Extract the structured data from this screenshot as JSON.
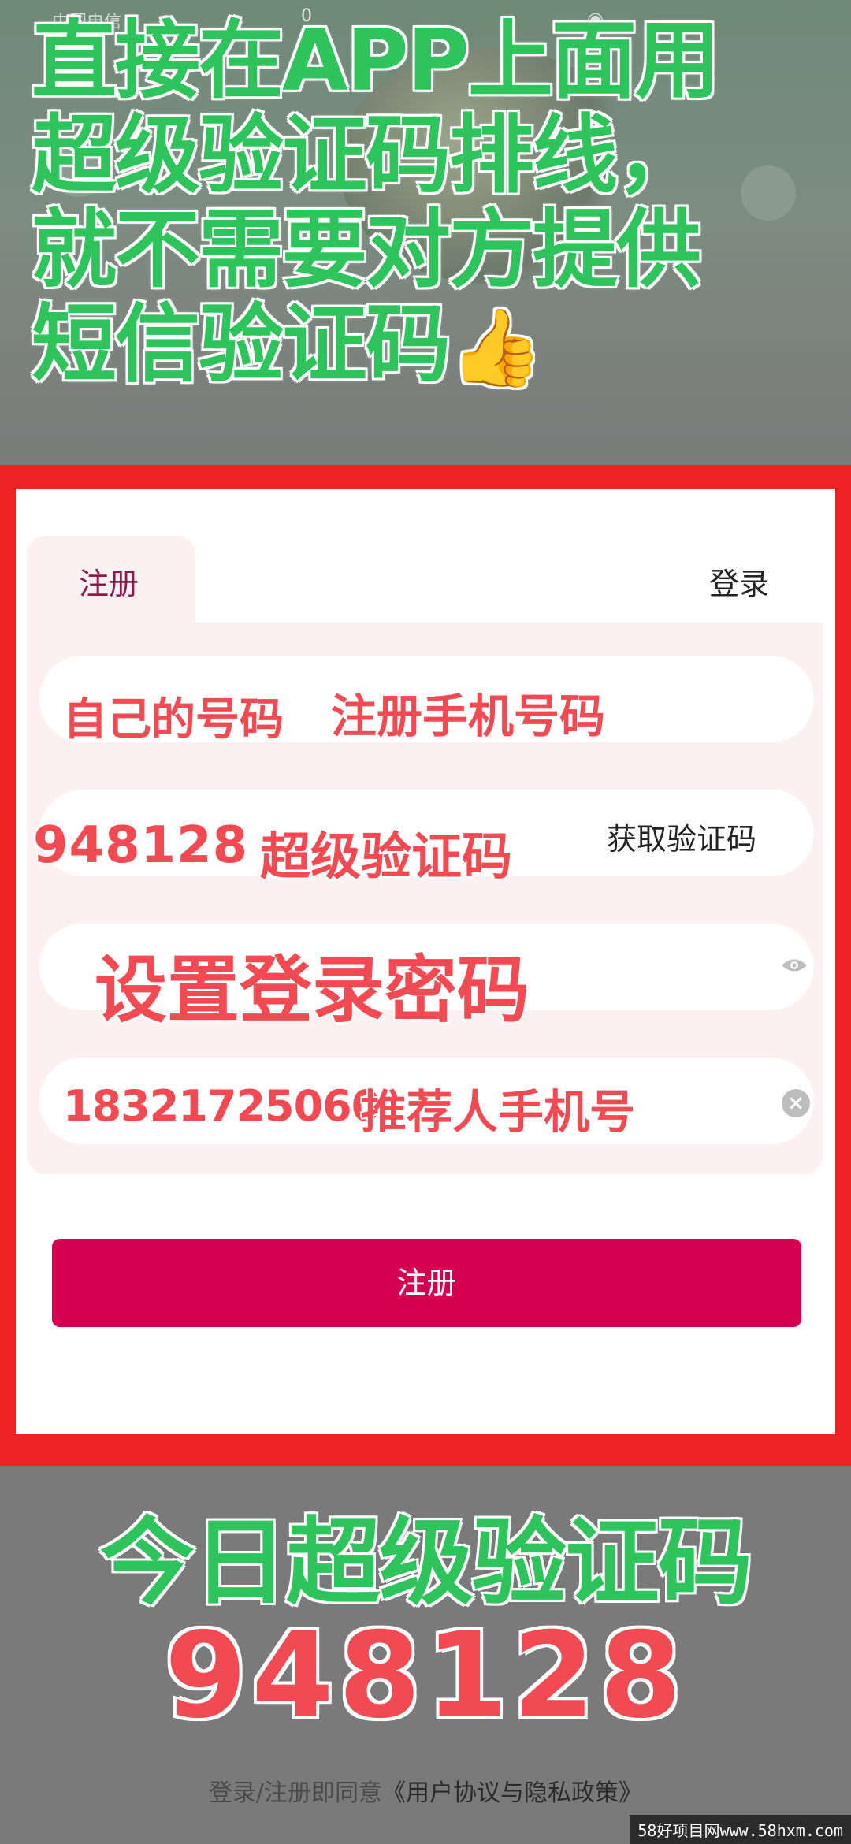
{
  "status_bar": {
    "carrier": "中国电信",
    "number": "0"
  },
  "overlay": {
    "headline_lines": [
      "直接在APP上面用",
      "超级验证码排线，",
      "就不需要对方提供",
      "短信验证码"
    ],
    "thumb": "👍"
  },
  "tabs": {
    "register": "注册",
    "login": "登录"
  },
  "form": {
    "phone_note": "自己的号码",
    "phone_note_2": "注册手机号码",
    "code_value": "948128",
    "code_note": "超级验证码",
    "get_code_label": "获取验证码",
    "password_note": "设置登录密码",
    "referrer_value": "18321725060",
    "referrer_note": "推荐人手机号"
  },
  "register_button_label": "注册",
  "bottom": {
    "title": "今日超级验证码",
    "code": "948128"
  },
  "agreement": {
    "prefix": "登录/注册即同意",
    "link": "《用户协议与隐私政策》"
  },
  "watermark": "58好项目网www.58hxm.com",
  "colors": {
    "headline_green": "#2ec45b",
    "note_red": "#f24a52",
    "frame_red": "#ee2222",
    "button_pink": "#d60050"
  }
}
